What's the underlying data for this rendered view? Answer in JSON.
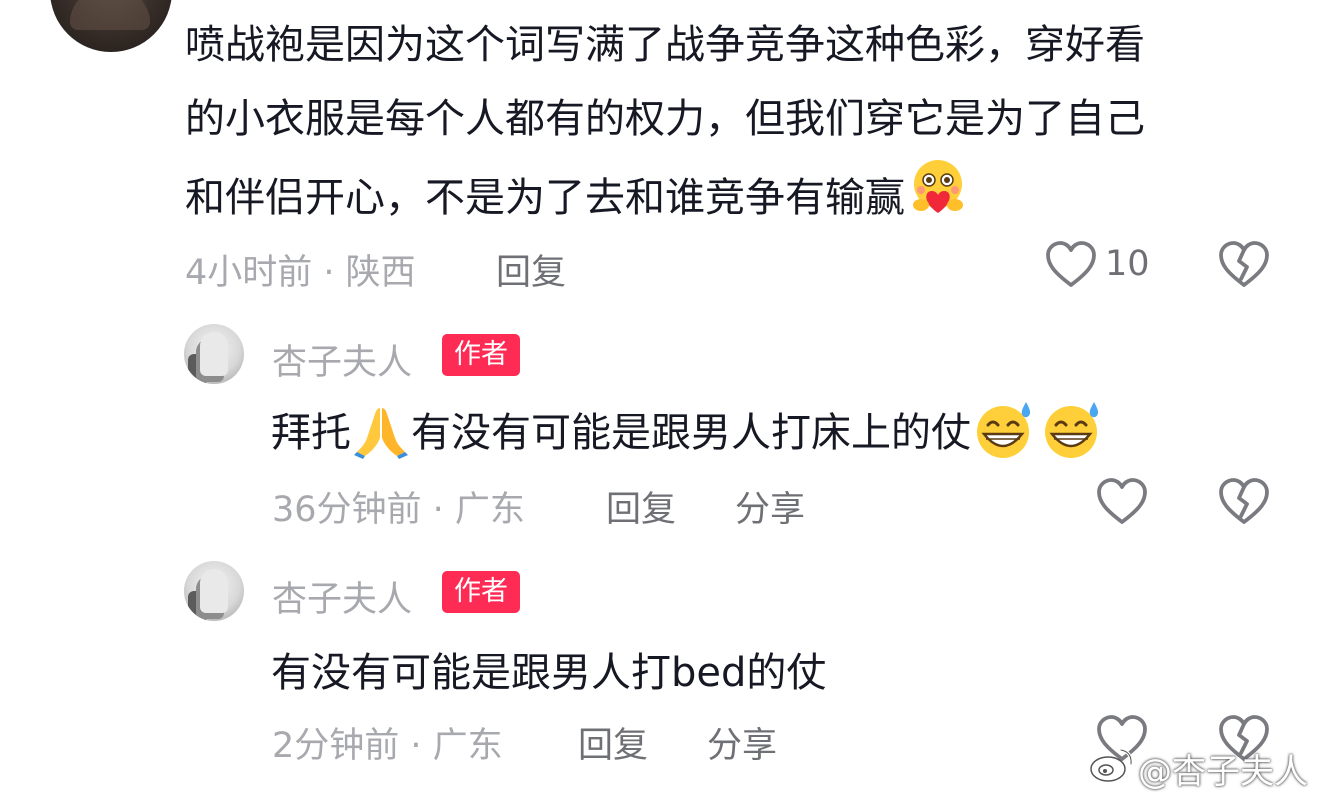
{
  "comment": {
    "lines": [
      "喷战袍是因为这个词写满了战争竞争这种色彩，穿好看",
      "的小衣服是每个人都有的权力，但我们穿它是为了自己",
      "和伴侣开心，不是为了去和谁竞争有输赢"
    ],
    "time_location": "4小时前 · 陕西",
    "reply_label": "回复",
    "likes": "10"
  },
  "replies": [
    {
      "author": "杏子夫人",
      "badge": "作者",
      "text_before_emoji": "拜托",
      "text_after_emoji": "有没有可能是跟男人打床上的仗",
      "time_location": "36分钟前 · 广东",
      "reply_label": "回复",
      "share_label": "分享"
    },
    {
      "author": "杏子夫人",
      "badge": "作者",
      "text": "有没有可能是跟男人打bed的仗",
      "time_location": "2分钟前 · 广东",
      "reply_label": "回复",
      "share_label": "分享"
    }
  ],
  "watermark": "@杏子夫人",
  "icons": {
    "like": "heart-outline-icon",
    "dislike": "broken-heart-icon",
    "hug_emoji": "hugging-face-emoji",
    "pray_emoji": "folded-hands-emoji",
    "sweat_emoji": "grinning-sweat-emoji",
    "weibo_logo": "weibo-logo-icon"
  }
}
